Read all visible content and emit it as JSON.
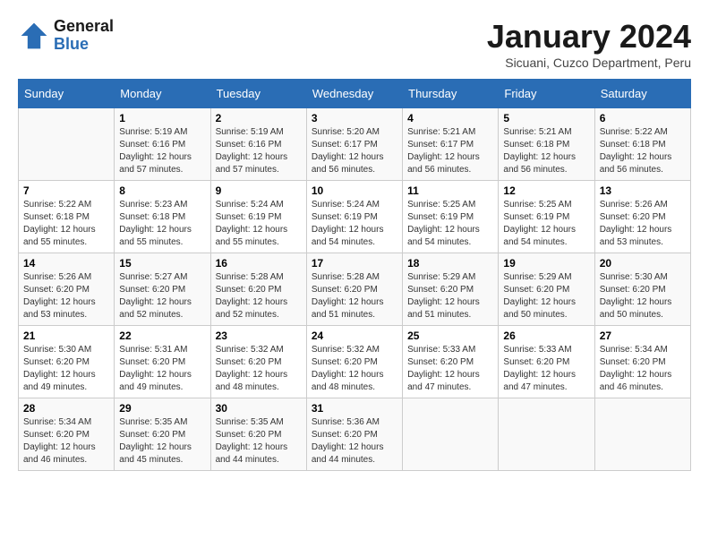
{
  "logo": {
    "general": "General",
    "blue": "Blue"
  },
  "header": {
    "title": "January 2024",
    "subtitle": "Sicuani, Cuzco Department, Peru"
  },
  "weekdays": [
    "Sunday",
    "Monday",
    "Tuesday",
    "Wednesday",
    "Thursday",
    "Friday",
    "Saturday"
  ],
  "weeks": [
    [
      {
        "day": "",
        "sunrise": "",
        "sunset": "",
        "daylight": ""
      },
      {
        "day": "1",
        "sunrise": "Sunrise: 5:19 AM",
        "sunset": "Sunset: 6:16 PM",
        "daylight": "Daylight: 12 hours and 57 minutes."
      },
      {
        "day": "2",
        "sunrise": "Sunrise: 5:19 AM",
        "sunset": "Sunset: 6:16 PM",
        "daylight": "Daylight: 12 hours and 57 minutes."
      },
      {
        "day": "3",
        "sunrise": "Sunrise: 5:20 AM",
        "sunset": "Sunset: 6:17 PM",
        "daylight": "Daylight: 12 hours and 56 minutes."
      },
      {
        "day": "4",
        "sunrise": "Sunrise: 5:21 AM",
        "sunset": "Sunset: 6:17 PM",
        "daylight": "Daylight: 12 hours and 56 minutes."
      },
      {
        "day": "5",
        "sunrise": "Sunrise: 5:21 AM",
        "sunset": "Sunset: 6:18 PM",
        "daylight": "Daylight: 12 hours and 56 minutes."
      },
      {
        "day": "6",
        "sunrise": "Sunrise: 5:22 AM",
        "sunset": "Sunset: 6:18 PM",
        "daylight": "Daylight: 12 hours and 56 minutes."
      }
    ],
    [
      {
        "day": "7",
        "sunrise": "Sunrise: 5:22 AM",
        "sunset": "Sunset: 6:18 PM",
        "daylight": "Daylight: 12 hours and 55 minutes."
      },
      {
        "day": "8",
        "sunrise": "Sunrise: 5:23 AM",
        "sunset": "Sunset: 6:18 PM",
        "daylight": "Daylight: 12 hours and 55 minutes."
      },
      {
        "day": "9",
        "sunrise": "Sunrise: 5:24 AM",
        "sunset": "Sunset: 6:19 PM",
        "daylight": "Daylight: 12 hours and 55 minutes."
      },
      {
        "day": "10",
        "sunrise": "Sunrise: 5:24 AM",
        "sunset": "Sunset: 6:19 PM",
        "daylight": "Daylight: 12 hours and 54 minutes."
      },
      {
        "day": "11",
        "sunrise": "Sunrise: 5:25 AM",
        "sunset": "Sunset: 6:19 PM",
        "daylight": "Daylight: 12 hours and 54 minutes."
      },
      {
        "day": "12",
        "sunrise": "Sunrise: 5:25 AM",
        "sunset": "Sunset: 6:19 PM",
        "daylight": "Daylight: 12 hours and 54 minutes."
      },
      {
        "day": "13",
        "sunrise": "Sunrise: 5:26 AM",
        "sunset": "Sunset: 6:20 PM",
        "daylight": "Daylight: 12 hours and 53 minutes."
      }
    ],
    [
      {
        "day": "14",
        "sunrise": "Sunrise: 5:26 AM",
        "sunset": "Sunset: 6:20 PM",
        "daylight": "Daylight: 12 hours and 53 minutes."
      },
      {
        "day": "15",
        "sunrise": "Sunrise: 5:27 AM",
        "sunset": "Sunset: 6:20 PM",
        "daylight": "Daylight: 12 hours and 52 minutes."
      },
      {
        "day": "16",
        "sunrise": "Sunrise: 5:28 AM",
        "sunset": "Sunset: 6:20 PM",
        "daylight": "Daylight: 12 hours and 52 minutes."
      },
      {
        "day": "17",
        "sunrise": "Sunrise: 5:28 AM",
        "sunset": "Sunset: 6:20 PM",
        "daylight": "Daylight: 12 hours and 51 minutes."
      },
      {
        "day": "18",
        "sunrise": "Sunrise: 5:29 AM",
        "sunset": "Sunset: 6:20 PM",
        "daylight": "Daylight: 12 hours and 51 minutes."
      },
      {
        "day": "19",
        "sunrise": "Sunrise: 5:29 AM",
        "sunset": "Sunset: 6:20 PM",
        "daylight": "Daylight: 12 hours and 50 minutes."
      },
      {
        "day": "20",
        "sunrise": "Sunrise: 5:30 AM",
        "sunset": "Sunset: 6:20 PM",
        "daylight": "Daylight: 12 hours and 50 minutes."
      }
    ],
    [
      {
        "day": "21",
        "sunrise": "Sunrise: 5:30 AM",
        "sunset": "Sunset: 6:20 PM",
        "daylight": "Daylight: 12 hours and 49 minutes."
      },
      {
        "day": "22",
        "sunrise": "Sunrise: 5:31 AM",
        "sunset": "Sunset: 6:20 PM",
        "daylight": "Daylight: 12 hours and 49 minutes."
      },
      {
        "day": "23",
        "sunrise": "Sunrise: 5:32 AM",
        "sunset": "Sunset: 6:20 PM",
        "daylight": "Daylight: 12 hours and 48 minutes."
      },
      {
        "day": "24",
        "sunrise": "Sunrise: 5:32 AM",
        "sunset": "Sunset: 6:20 PM",
        "daylight": "Daylight: 12 hours and 48 minutes."
      },
      {
        "day": "25",
        "sunrise": "Sunrise: 5:33 AM",
        "sunset": "Sunset: 6:20 PM",
        "daylight": "Daylight: 12 hours and 47 minutes."
      },
      {
        "day": "26",
        "sunrise": "Sunrise: 5:33 AM",
        "sunset": "Sunset: 6:20 PM",
        "daylight": "Daylight: 12 hours and 47 minutes."
      },
      {
        "day": "27",
        "sunrise": "Sunrise: 5:34 AM",
        "sunset": "Sunset: 6:20 PM",
        "daylight": "Daylight: 12 hours and 46 minutes."
      }
    ],
    [
      {
        "day": "28",
        "sunrise": "Sunrise: 5:34 AM",
        "sunset": "Sunset: 6:20 PM",
        "daylight": "Daylight: 12 hours and 46 minutes."
      },
      {
        "day": "29",
        "sunrise": "Sunrise: 5:35 AM",
        "sunset": "Sunset: 6:20 PM",
        "daylight": "Daylight: 12 hours and 45 minutes."
      },
      {
        "day": "30",
        "sunrise": "Sunrise: 5:35 AM",
        "sunset": "Sunset: 6:20 PM",
        "daylight": "Daylight: 12 hours and 44 minutes."
      },
      {
        "day": "31",
        "sunrise": "Sunrise: 5:36 AM",
        "sunset": "Sunset: 6:20 PM",
        "daylight": "Daylight: 12 hours and 44 minutes."
      },
      {
        "day": "",
        "sunrise": "",
        "sunset": "",
        "daylight": ""
      },
      {
        "day": "",
        "sunrise": "",
        "sunset": "",
        "daylight": ""
      },
      {
        "day": "",
        "sunrise": "",
        "sunset": "",
        "daylight": ""
      }
    ]
  ]
}
